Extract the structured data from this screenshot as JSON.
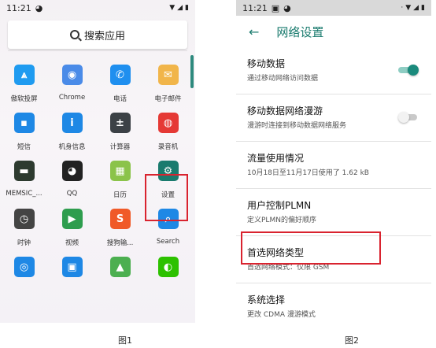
{
  "figure1": {
    "status": {
      "time": "11:21"
    },
    "search": {
      "label": "搜索应用"
    },
    "apps": [
      {
        "name": "app-aosense",
        "label": "傲软投屏",
        "color": "#1f9bf0",
        "glyph": "⩓"
      },
      {
        "name": "app-chrome",
        "label": "Chrome",
        "color": "#4a8be8",
        "glyph": "◉"
      },
      {
        "name": "app-phone",
        "label": "电话",
        "color": "#1f8fef",
        "glyph": "✆"
      },
      {
        "name": "app-email",
        "label": "电子邮件",
        "color": "#f1b54a",
        "glyph": "✉"
      },
      {
        "name": "app-messages",
        "label": "短信",
        "color": "#1e88e5",
        "glyph": "▪"
      },
      {
        "name": "app-device-info",
        "label": "机身信息",
        "color": "#1e88e5",
        "glyph": "i"
      },
      {
        "name": "app-calculator",
        "label": "计算器",
        "color": "#3c4146",
        "glyph": "±"
      },
      {
        "name": "app-recorder",
        "label": "录音机",
        "color": "#e53935",
        "glyph": "◍"
      },
      {
        "name": "app-memsic",
        "label": "MEMSIC_...",
        "color": "#2d3a2f",
        "glyph": "▬"
      },
      {
        "name": "app-qq",
        "label": "QQ",
        "color": "#222222",
        "glyph": "◕"
      },
      {
        "name": "app-calendar",
        "label": "日历",
        "color": "#8bc34a",
        "glyph": "▦"
      },
      {
        "name": "app-settings",
        "label": "设置",
        "color": "#1a7b6e",
        "glyph": "⚙"
      },
      {
        "name": "app-clock",
        "label": "时钟",
        "color": "#444444",
        "glyph": "◷"
      },
      {
        "name": "app-video",
        "label": "视频",
        "color": "#2e9d4e",
        "glyph": "▶"
      },
      {
        "name": "app-sogou",
        "label": "搜狗输...",
        "color": "#f05a28",
        "glyph": "S"
      },
      {
        "name": "app-search",
        "label": "Search",
        "color": "#1e88e5",
        "glyph": "⌕"
      },
      {
        "name": "app-browser",
        "label": "",
        "color": "#1e88e5",
        "glyph": "◎"
      },
      {
        "name": "app-contacts",
        "label": "",
        "color": "#1e88e5",
        "glyph": "▣"
      },
      {
        "name": "app-gallery",
        "label": "",
        "color": "#4caf50",
        "glyph": "▲"
      },
      {
        "name": "app-wechat",
        "label": "",
        "color": "#2dc100",
        "glyph": "◐"
      }
    ],
    "caption": "图1"
  },
  "figure2": {
    "status": {
      "time": "11:21"
    },
    "header": {
      "title": "网络设置"
    },
    "prefs": [
      {
        "title": "移动数据",
        "summary": "通过移动网络访问数据",
        "switch": "on"
      },
      {
        "title": "移动数据网络漫游",
        "summary": "漫游时连接到移动数据网络服务",
        "switch": "off"
      },
      {
        "title": "流量使用情况",
        "summary": "10月18日至11月17日使用了 1.62 kB"
      },
      {
        "title": "用户控制PLMN",
        "summary": "定义PLMN的偏好顺序"
      },
      {
        "title": "首选网络类型",
        "summary": "首选网络模式：仅限 GSM"
      },
      {
        "title": "系统选择",
        "summary": "更改 CDMA 漫游模式"
      }
    ],
    "caption": "图2"
  },
  "colors": {
    "accent": "#1a7b6e",
    "highlight": "#d9232f"
  }
}
